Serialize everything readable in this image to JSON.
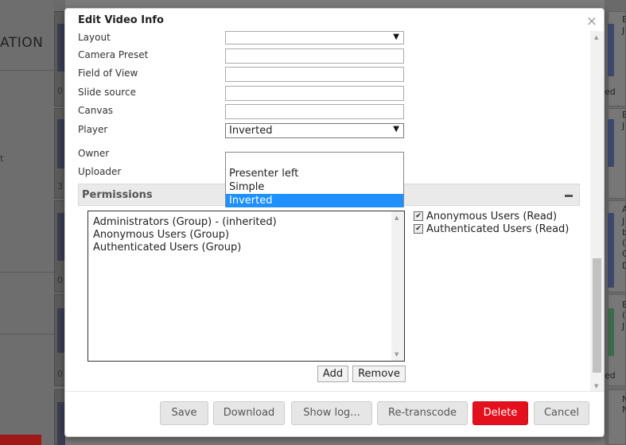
{
  "background": {
    "page_title": "ATION",
    "left_snippets": [
      "0",
      "t",
      "3",
      "0",
      "0"
    ],
    "right_snippets": [
      "E",
      "J",
      "ed",
      "E",
      "J",
      "A",
      "J",
      "b",
      "(",
      "C",
      "D",
      "E",
      "(",
      "J",
      "ed",
      "N",
      "N"
    ]
  },
  "modal": {
    "title": "Edit Video Info",
    "close_label": "×",
    "fields": [
      {
        "label": "Layout",
        "value": ""
      },
      {
        "label": "Camera Preset",
        "value": ""
      },
      {
        "label": "Field of View",
        "value": ""
      },
      {
        "label": "Slide source",
        "value": ""
      },
      {
        "label": "Canvas",
        "value": ""
      },
      {
        "label": "Player",
        "value": "Inverted"
      },
      {
        "label": "Owner",
        "value": ""
      },
      {
        "label": "Uploader",
        "value": ""
      }
    ],
    "player_dropdown": {
      "options": [
        "",
        "Presenter left",
        "Simple",
        "Inverted"
      ],
      "selected": "Inverted"
    },
    "permissions": {
      "header": "Permissions",
      "list": [
        "Administrators (Group) - (inherited)",
        "Anonymous Users (Group)",
        "Authenticated Users (Group)"
      ],
      "checks": [
        {
          "label": "Anonymous Users (Read)",
          "checked": true
        },
        {
          "label": "Authenticated Users (Read)",
          "checked": true
        }
      ],
      "add_label": "Add",
      "remove_label": "Remove"
    },
    "footer": {
      "save": "Save",
      "download": "Download",
      "show_log": "Show log...",
      "retranscode": "Re-transcode",
      "delete": "Delete",
      "cancel": "Cancel"
    },
    "colors": {
      "danger": "#e5101d",
      "selection": "#1e90ff"
    }
  }
}
